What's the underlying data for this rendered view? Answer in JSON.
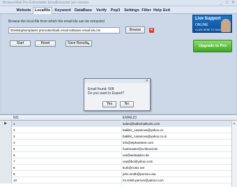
{
  "window": {
    "title": "BrowserMail Pro Extractable EmailExtractor pro version",
    "minimize": "_",
    "maximize": "□",
    "close": "✕"
  },
  "menu": [
    {
      "label": "Website"
    },
    {
      "label": "Localfile"
    },
    {
      "label": "Keyword"
    },
    {
      "label": "DataBase"
    },
    {
      "label": "Verify"
    },
    {
      "label": "Pop3"
    },
    {
      "label": "Settings"
    },
    {
      "label": "Filter"
    },
    {
      "label": "Help"
    },
    {
      "label": "Exit"
    }
  ],
  "localfile": {
    "instruction": "Browse the local file from which the email ids can be extracted",
    "path_value": "\\Desktop\\templates promotion\\bulk email software email ids.csv",
    "browse_label": "Browse",
    "start_label": "Start",
    "reset_label": "Reset",
    "save_results_label": "Save Results"
  },
  "live_support": {
    "line1": "Live Support",
    "line2": "ONLINE",
    "line3": "CLICK HERE TO TALK"
  },
  "upgrade_label": "Upgrade to Pro",
  "dialog": {
    "message_line1": "Email found: 568",
    "message_line2": "Do you want to Export?",
    "yes_label": "Yes",
    "no_label": "No"
  },
  "grid": {
    "columns": [
      "NO",
      "EMAILID"
    ],
    "rows": [
      {
        "no": "1",
        "email": "sales@bulkemailtools.com"
      },
      {
        "no": "2",
        "email": "baklitic_casanova@yahoo.co"
      },
      {
        "no": "3",
        "email": "baklitic_casanova@yahoo.co.in"
      },
      {
        "no": "4",
        "email": "info@elphanttree.com"
      },
      {
        "no": "5",
        "email": "hostmaster@uchkund.de"
      },
      {
        "no": "6",
        "email": "unt@webalytics.de"
      },
      {
        "no": "7",
        "email": "usa@bo@yahoo.com"
      },
      {
        "no": "8",
        "email": "kurk@nc6iz.net"
      },
      {
        "no": "9",
        "email": "john.smith@person.usa"
      },
      {
        "no": "10",
        "email": "mr.smith.person@yahoo.com"
      }
    ]
  }
}
